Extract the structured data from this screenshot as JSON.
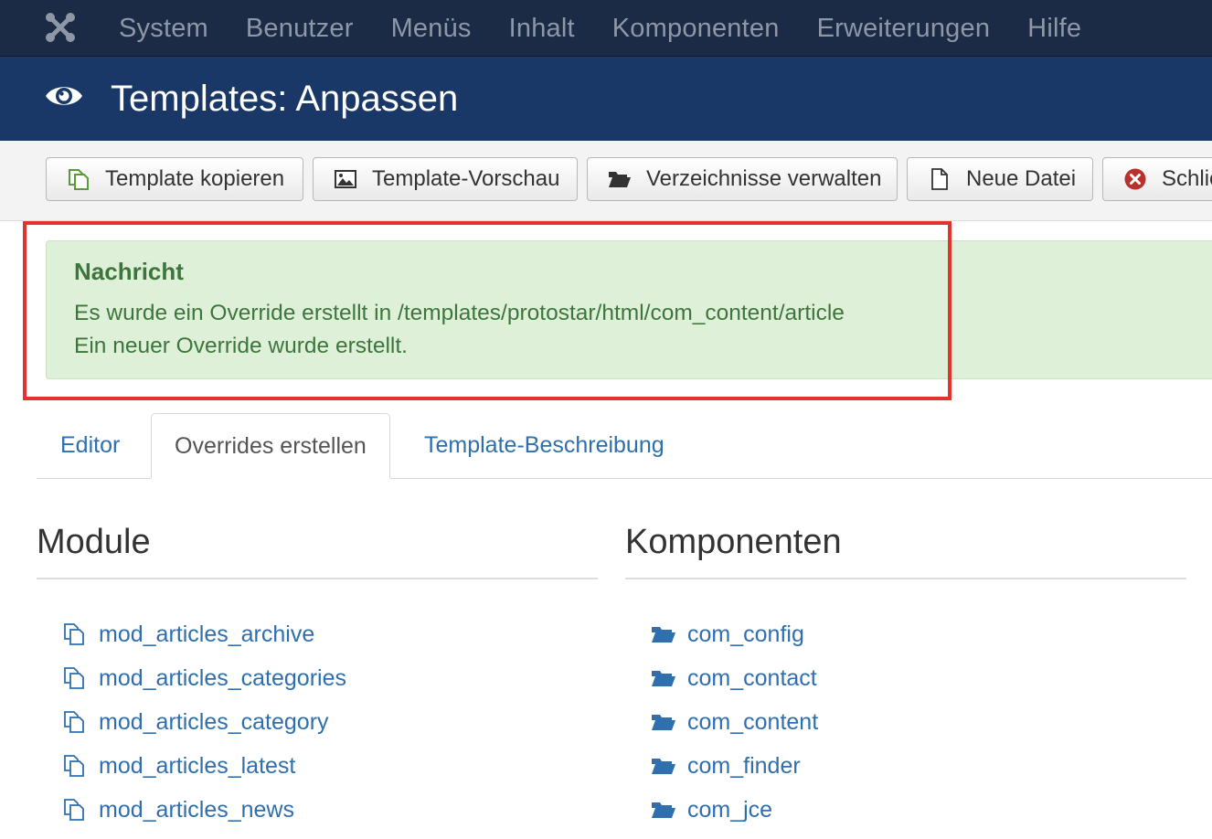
{
  "topnav": {
    "logo_icon": "joomla-logo-icon",
    "items": [
      "System",
      "Benutzer",
      "Menüs",
      "Inhalt",
      "Komponenten",
      "Erweiterungen",
      "Hilfe"
    ]
  },
  "header": {
    "icon": "eye-icon",
    "title": "Templates: Anpassen"
  },
  "toolbar": {
    "buttons": [
      {
        "label": "Template kopieren",
        "icon": "copy-icon"
      },
      {
        "label": "Template-Vorschau",
        "icon": "picture-icon"
      },
      {
        "label": "Verzeichnisse verwalten",
        "icon": "folder-icon"
      },
      {
        "label": "Neue Datei",
        "icon": "file-icon"
      },
      {
        "label": "Schlie",
        "icon": "close-circle-icon"
      }
    ]
  },
  "message": {
    "heading": "Nachricht",
    "line1": "Es wurde ein Override erstellt in /templates/protostar/html/com_content/article",
    "line2": "Ein neuer Override wurde erstellt.",
    "highlight_color": "#e2332c"
  },
  "tabs": [
    {
      "label": "Editor",
      "active": false
    },
    {
      "label": "Overrides erstellen",
      "active": true
    },
    {
      "label": "Template-Beschreibung",
      "active": false
    }
  ],
  "modules": {
    "title": "Module",
    "items": [
      "mod_articles_archive",
      "mod_articles_categories",
      "mod_articles_category",
      "mod_articles_latest",
      "mod_articles_news"
    ]
  },
  "components": {
    "title": "Komponenten",
    "items": [
      "com_config",
      "com_contact",
      "com_content",
      "com_finder",
      "com_jce"
    ]
  },
  "colors": {
    "nav_bg": "#1b2b45",
    "header_bg": "#1a3867",
    "link": "#2f6fad",
    "success_bg": "#dff0d8",
    "success_text": "#3c763d"
  }
}
